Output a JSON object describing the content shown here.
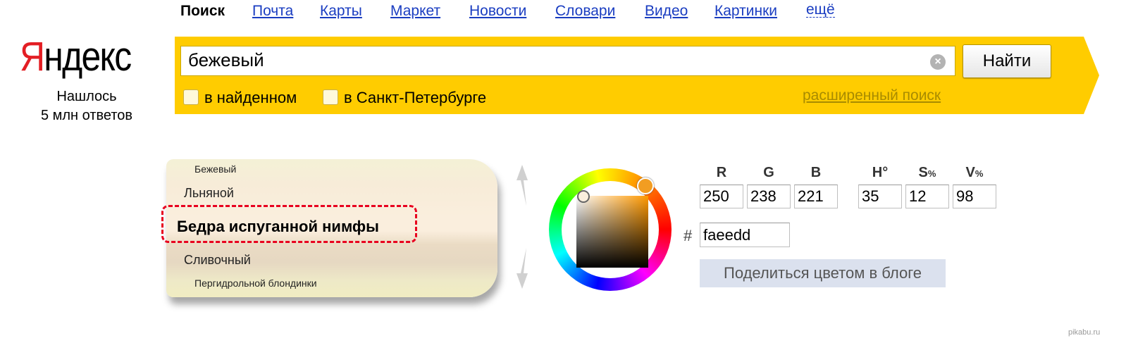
{
  "nav": {
    "active": "Поиск",
    "links": [
      "Почта",
      "Карты",
      "Маркет",
      "Новости",
      "Словари",
      "Видео",
      "Картинки"
    ],
    "more": "ещё"
  },
  "logo": {
    "ya": "Я",
    "rest": "ндекс"
  },
  "found": {
    "line1": "Нашлось",
    "line2": "5 млн ответов"
  },
  "search": {
    "query": "бежевый",
    "button": "Найти",
    "options": [
      "в найденном",
      "в Санкт-Петербурге"
    ],
    "advanced": "расширенный поиск"
  },
  "color_names": {
    "items": [
      "Бежевый",
      "Льняной",
      "Бедра испуганной нимфы",
      "Сливочный",
      "Пергидрольной блондинки"
    ],
    "selected": "Бедра испуганной нимфы"
  },
  "picker": {
    "labels": {
      "r": "R",
      "g": "G",
      "b": "B",
      "h": "H°",
      "s": "S",
      "v": "V",
      "pct": "%"
    },
    "r": "250",
    "g": "238",
    "b": "221",
    "h": "35",
    "s": "12",
    "v": "98",
    "hash": "#",
    "hex": "faeedd",
    "share": "Поделиться цветом в блоге"
  },
  "watermark": "pikabu.ru",
  "colors": {
    "bar": "#ffcc00",
    "link": "#1a3dc1",
    "logo_red": "#e31e24",
    "selected_color": "#faeedd",
    "highlight": "#e8001f"
  }
}
